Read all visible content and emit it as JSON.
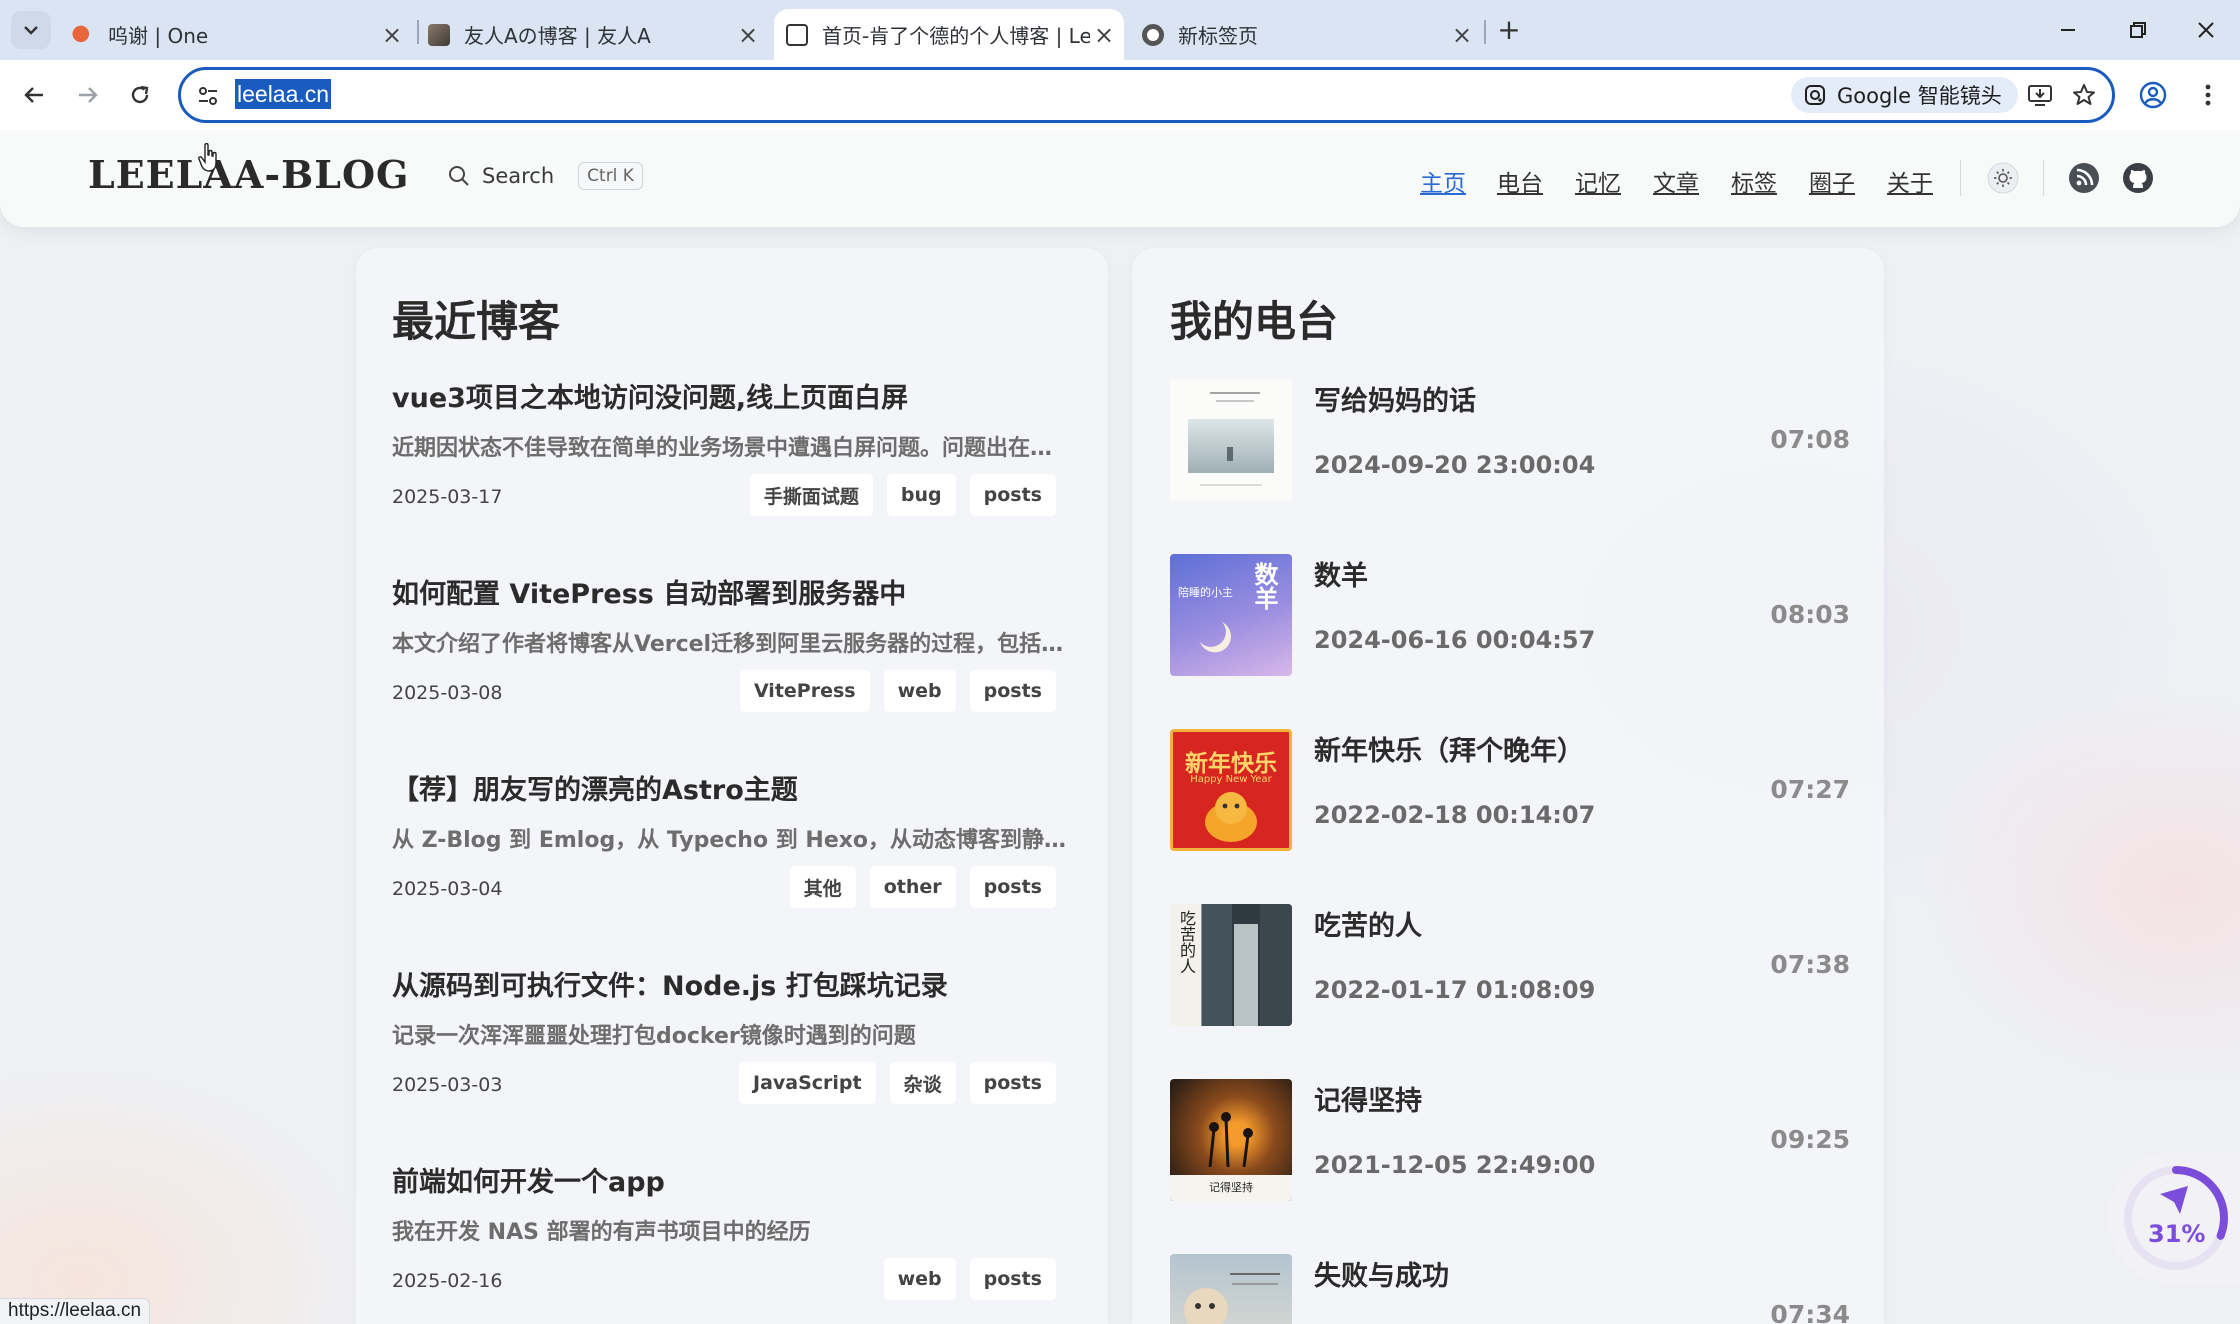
{
  "browser": {
    "tabs": [
      {
        "title": "呜谢 | One",
        "active": false
      },
      {
        "title": "友人Aの博客 | 友人A",
        "active": false
      },
      {
        "title": "首页-肯了个德的个人博客 | Leelaa",
        "active": true
      },
      {
        "title": "新标签页",
        "active": false
      }
    ],
    "url": "leelaa.cn",
    "lens_label": "Google 智能镜头",
    "status_url": "https://leelaa.cn"
  },
  "site": {
    "logo": "LEELAA-BLOG",
    "search_label": "Search",
    "search_shortcut": "Ctrl K",
    "nav": [
      {
        "label": "主页",
        "current": true
      },
      {
        "label": "电台",
        "current": false
      },
      {
        "label": "记忆",
        "current": false
      },
      {
        "label": "文章",
        "current": false
      },
      {
        "label": "标签",
        "current": false
      },
      {
        "label": "圈子",
        "current": false
      },
      {
        "label": "关于",
        "current": false
      }
    ],
    "accent_color": "#2a6bd3"
  },
  "blogs": {
    "heading": "最近博客",
    "posts": [
      {
        "title": "vue3项目之本地访问没问题,线上页面白屏",
        "desc": "近期因状态不佳导致在简单的业务场景中遭遇白屏问题。问题出在路由配置的history模式上……",
        "date": "2025-03-17",
        "tags": [
          "手撕面试题",
          "bug",
          "posts"
        ]
      },
      {
        "title": "如何配置 VitePress 自动部署到服务器中",
        "desc": "本文介绍了作者将博客从Vercel迁移到阿里云服务器的过程，包括……",
        "date": "2025-03-08",
        "tags": [
          "VitePress",
          "web",
          "posts"
        ]
      },
      {
        "title": "【荐】朋友写的漂亮的Astro主题",
        "desc": "从 Z-Blog 到 Emlog，从 Typecho 到 Hexo，从动态博客到静态博客……",
        "date": "2025-03-04",
        "tags": [
          "其他",
          "other",
          "posts"
        ]
      },
      {
        "title": "从源码到可执行文件：Node.js 打包踩坑记录",
        "desc": "记录一次浑浑噩噩处理打包docker镜像时遇到的问题",
        "date": "2025-03-03",
        "tags": [
          "JavaScript",
          "杂谈",
          "posts"
        ]
      },
      {
        "title": "前端如何开发一个app",
        "desc": "我在开发 NAS 部署的有声书项目中的经历",
        "date": "2025-02-16",
        "tags": [
          "web",
          "posts"
        ]
      }
    ]
  },
  "radio": {
    "heading": "我的电台",
    "episodes": [
      {
        "title": "写给妈妈的话",
        "date": "2024-09-20 23:00:04",
        "duration": "07:08"
      },
      {
        "title": "数羊",
        "date": "2024-06-16 00:04:57",
        "duration": "08:03",
        "cover_text": "数羊",
        "cover_sub": "陪睡的小主"
      },
      {
        "title": "新年快乐（拜个晚年）",
        "date": "2022-02-18 00:14:07",
        "duration": "07:27",
        "cover_text": "新年快乐",
        "cover_sub": "Happy New Year"
      },
      {
        "title": "吃苦的人",
        "date": "2022-01-17 01:08:09",
        "duration": "07:38",
        "cover_text": "吃苦的人"
      },
      {
        "title": "记得坚持",
        "date": "2021-12-05 22:49:00",
        "duration": "09:25",
        "cover_text": "记得坚持"
      },
      {
        "title": "失败与成功",
        "date": "",
        "duration": "07:34"
      }
    ]
  },
  "reading_progress": {
    "value": 0.31,
    "label": "31%",
    "color": "#7c4ddb"
  }
}
